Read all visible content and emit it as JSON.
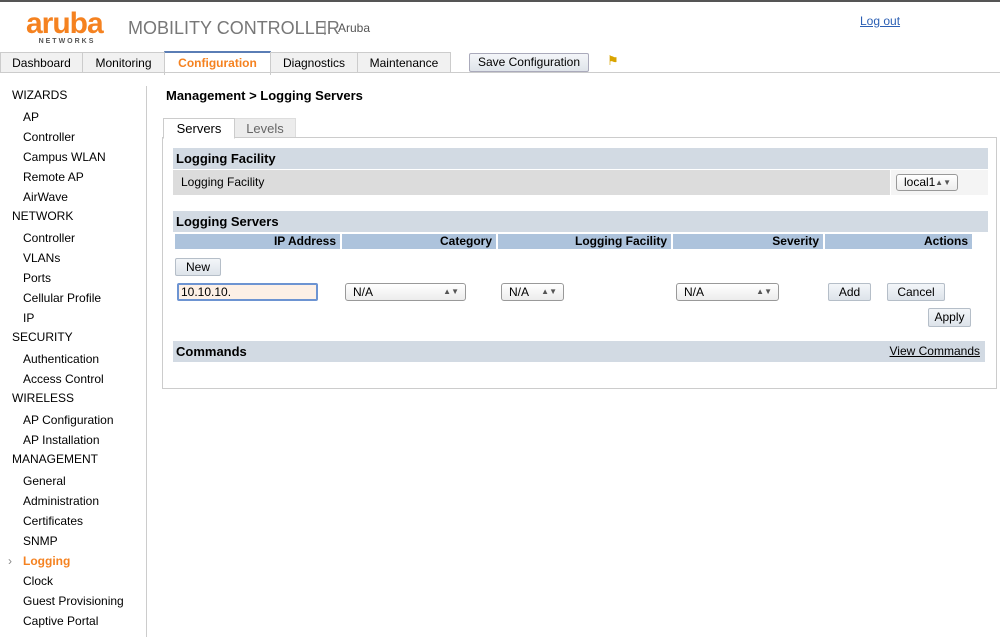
{
  "header": {
    "logo_text": "aruba",
    "logo_sub": "NETWORKS",
    "product": "MOBILITY CONTROLLER",
    "separator": "|",
    "controller_name": "Aruba",
    "logout": "Log out"
  },
  "nav": {
    "tabs": [
      {
        "label": "Dashboard"
      },
      {
        "label": "Monitoring"
      },
      {
        "label": "Configuration",
        "active": true
      },
      {
        "label": "Diagnostics"
      },
      {
        "label": "Maintenance"
      }
    ],
    "save_label": "Save Configuration",
    "flag_icon": "flag-icon"
  },
  "sidebar": {
    "sections": [
      {
        "title": "WIZARDS",
        "items": [
          "AP",
          "Controller",
          "Campus WLAN",
          "Remote AP",
          "AirWave"
        ]
      },
      {
        "title": "NETWORK",
        "items": [
          "Controller",
          "VLANs",
          "Ports",
          "Cellular Profile",
          "IP"
        ]
      },
      {
        "title": "SECURITY",
        "items": [
          "Authentication",
          "Access Control"
        ]
      },
      {
        "title": "WIRELESS",
        "items": [
          "AP Configuration",
          "AP Installation"
        ]
      },
      {
        "title": "MANAGEMENT",
        "items": [
          "General",
          "Administration",
          "Certificates",
          "SNMP",
          "Logging",
          "Clock",
          "Guest Provisioning",
          "Captive Portal"
        ]
      }
    ],
    "active_item": "Logging"
  },
  "main": {
    "title": "Management > Logging Servers",
    "tabs": [
      {
        "label": "Servers",
        "active": true
      },
      {
        "label": "Levels"
      }
    ],
    "facility": {
      "header": "Logging Facility",
      "label": "Logging Facility",
      "value": "local1"
    },
    "servers": {
      "header": "Logging Servers",
      "columns": [
        "IP Address",
        "Category",
        "Logging Facility",
        "Severity",
        "Actions"
      ],
      "new_label": "New",
      "ip_value": "10.10.10.",
      "category": "N/A",
      "facility": "N/A",
      "severity": "N/A",
      "add_label": "Add",
      "cancel_label": "Cancel",
      "apply_label": "Apply"
    },
    "commands": {
      "header": "Commands",
      "link": "View Commands"
    }
  },
  "colors": {
    "accent": "#f58220",
    "header_bg": "#d2dae3",
    "column_bg": "#adc3dc"
  }
}
